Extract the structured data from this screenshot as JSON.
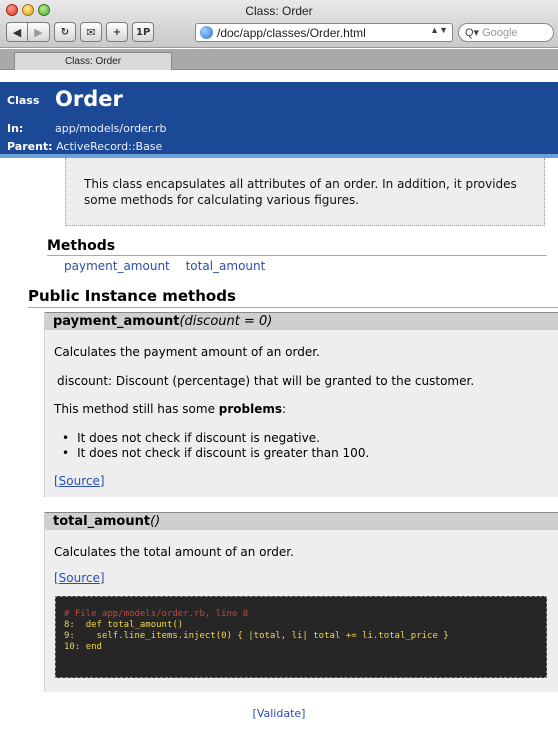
{
  "window": {
    "title": "Class: Order"
  },
  "toolbar": {
    "back_icon": "back-arrow-icon",
    "forward_icon": "forward-arrow-icon",
    "reload_glyph": "C",
    "snap_glyph": "✂",
    "add_glyph": "+",
    "pdf_glyph": "1P",
    "url": "/doc/app/classes/Order.html",
    "search_placeholder": "Google"
  },
  "tab": {
    "label": "Class: Order"
  },
  "banner": {
    "class_label": "Class",
    "class_name": "Order",
    "in_label": "In:",
    "in_value": "app/models/order.rb",
    "parent_label": "Parent:",
    "parent_value": "ActiveRecord::Base",
    "bg_color": "#1c4996"
  },
  "description": "This class encapsulates all attributes of an order. In addition, it provides some methods for calculating various figures.",
  "methods": {
    "heading": "Methods",
    "links": [
      "payment_amount",
      "total_amount"
    ]
  },
  "public_heading": "Public Instance methods",
  "payment_amount": {
    "name": "payment_amount",
    "params": "(discount = 0)",
    "line1": "Calculates the payment amount of an order.",
    "line2": "discount: Discount (percentage) that will be granted to the customer.",
    "line3_prefix": "This method still has some ",
    "line3_bold": "problems",
    "line3_suffix": ":",
    "bullets": [
      "It does not check if discount is negative.",
      "It does not check if discount is greater than 100."
    ],
    "source_label": "[Source]"
  },
  "total_amount": {
    "name": "total_amount",
    "params": "()",
    "line1": "Calculates the total amount of an order.",
    "source_label": "[Source]",
    "code": {
      "comment": "# File app/models/order.rb, line 8",
      "lines": [
        {
          "num": "8:",
          "text": "def total_amount()"
        },
        {
          "num": "9:",
          "text": "  self.line_items.inject(0) { |total, li| total += li.total_price }"
        },
        {
          "num": "10:",
          "text": "end"
        }
      ]
    }
  },
  "footer": {
    "validate_label": "[Validate]"
  }
}
